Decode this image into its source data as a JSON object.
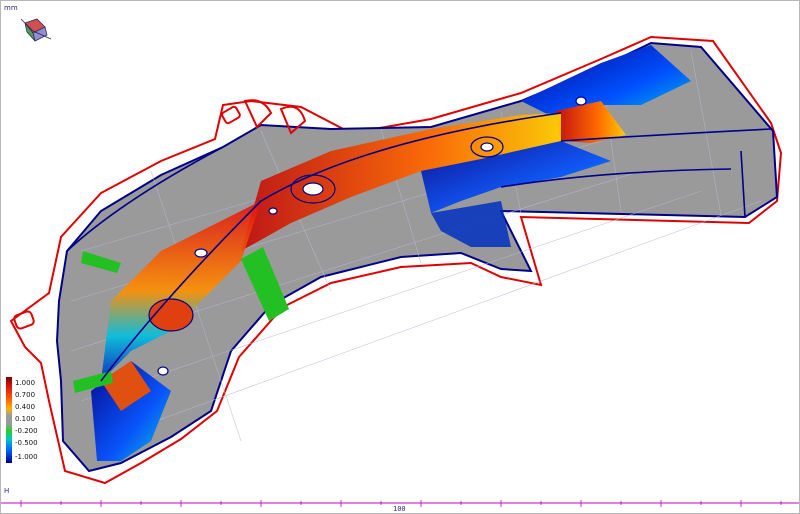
{
  "viewport": {
    "unit_label": "mm",
    "axis_letter": "H",
    "ruler_label": "100"
  },
  "legend": {
    "labels": [
      "1.000",
      "0.700",
      "0.400",
      "0.100",
      "-0.200",
      "-0.500",
      "-1.000"
    ],
    "colors": [
      "#c00000",
      "#ff5a00",
      "#ffb000",
      "#9a9a9a",
      "#23d023",
      "#0068ff",
      "#000090"
    ]
  },
  "part": {
    "outline_color": "#e00000",
    "edge_color": "#00008a",
    "surface_color": "#9a9a9a",
    "mesh_color": "#a8a8c8"
  },
  "icons": {
    "orientation_triad": "orientation-triad-icon"
  }
}
